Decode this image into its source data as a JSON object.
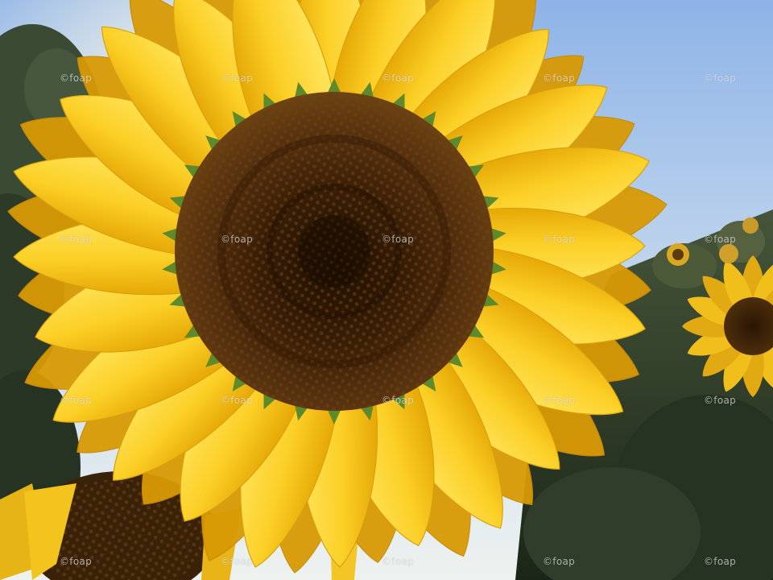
{
  "image": {
    "subject": "sunflower",
    "palette": {
      "sky_top": "#8fb4e6",
      "sky_bottom": "#eef3f5",
      "petal": "#f6c21a",
      "petal_light": "#ffe25a",
      "petal_shadow": "#d99a05",
      "disk": "#3a2008",
      "disk_ring": "#6b3d10",
      "foliage": "#2e3b26"
    }
  },
  "watermark": {
    "text": "©foap"
  }
}
